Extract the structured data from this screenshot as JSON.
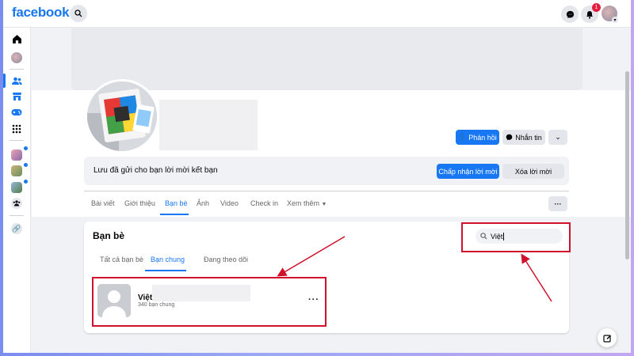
{
  "topbar": {
    "logo": "facebook",
    "search_icon": "search-icon",
    "messenger_icon": "messenger-icon",
    "notifications_icon": "bell-icon",
    "notification_count": "1"
  },
  "rail": {
    "items": [
      {
        "icon": "home-icon"
      },
      {
        "icon": "profile-avatar"
      },
      {
        "icon": "friends-icon"
      },
      {
        "icon": "marketplace-icon"
      },
      {
        "icon": "gaming-icon"
      },
      {
        "icon": "menu-grid-icon"
      },
      {
        "icon": "group-avatar"
      },
      {
        "icon": "group-avatar"
      },
      {
        "icon": "group-avatar"
      },
      {
        "icon": "groups-icon"
      },
      {
        "icon": "link-icon"
      }
    ]
  },
  "profile": {
    "buttons": {
      "respond": "Phản hồi",
      "message": "Nhắn tin",
      "more_icon": "chevron-down-icon"
    },
    "request_text": "Lưu đã gửi cho bạn lời mời kết bạn",
    "accept_label": "Chấp nhận lời mời",
    "delete_label": "Xóa lời mời",
    "tabs": [
      "Bài viết",
      "Giới thiệu",
      "Bạn bè",
      "Ảnh",
      "Video",
      "Check in",
      "Xem thêm"
    ],
    "active_tab": "Bạn bè"
  },
  "friends": {
    "title": "Bạn bè",
    "search_value": "Việt",
    "subtabs": [
      "Tất cả bạn bè",
      "Bạn chung",
      "Đang theo dõi"
    ],
    "active_subtab": "Bạn chung",
    "results": [
      {
        "name": "Việt",
        "mutual": "340 bạn chung"
      }
    ]
  },
  "colors": {
    "brand": "#1877f2",
    "annotation": "#d0112b",
    "badge": "#e41e3f"
  }
}
